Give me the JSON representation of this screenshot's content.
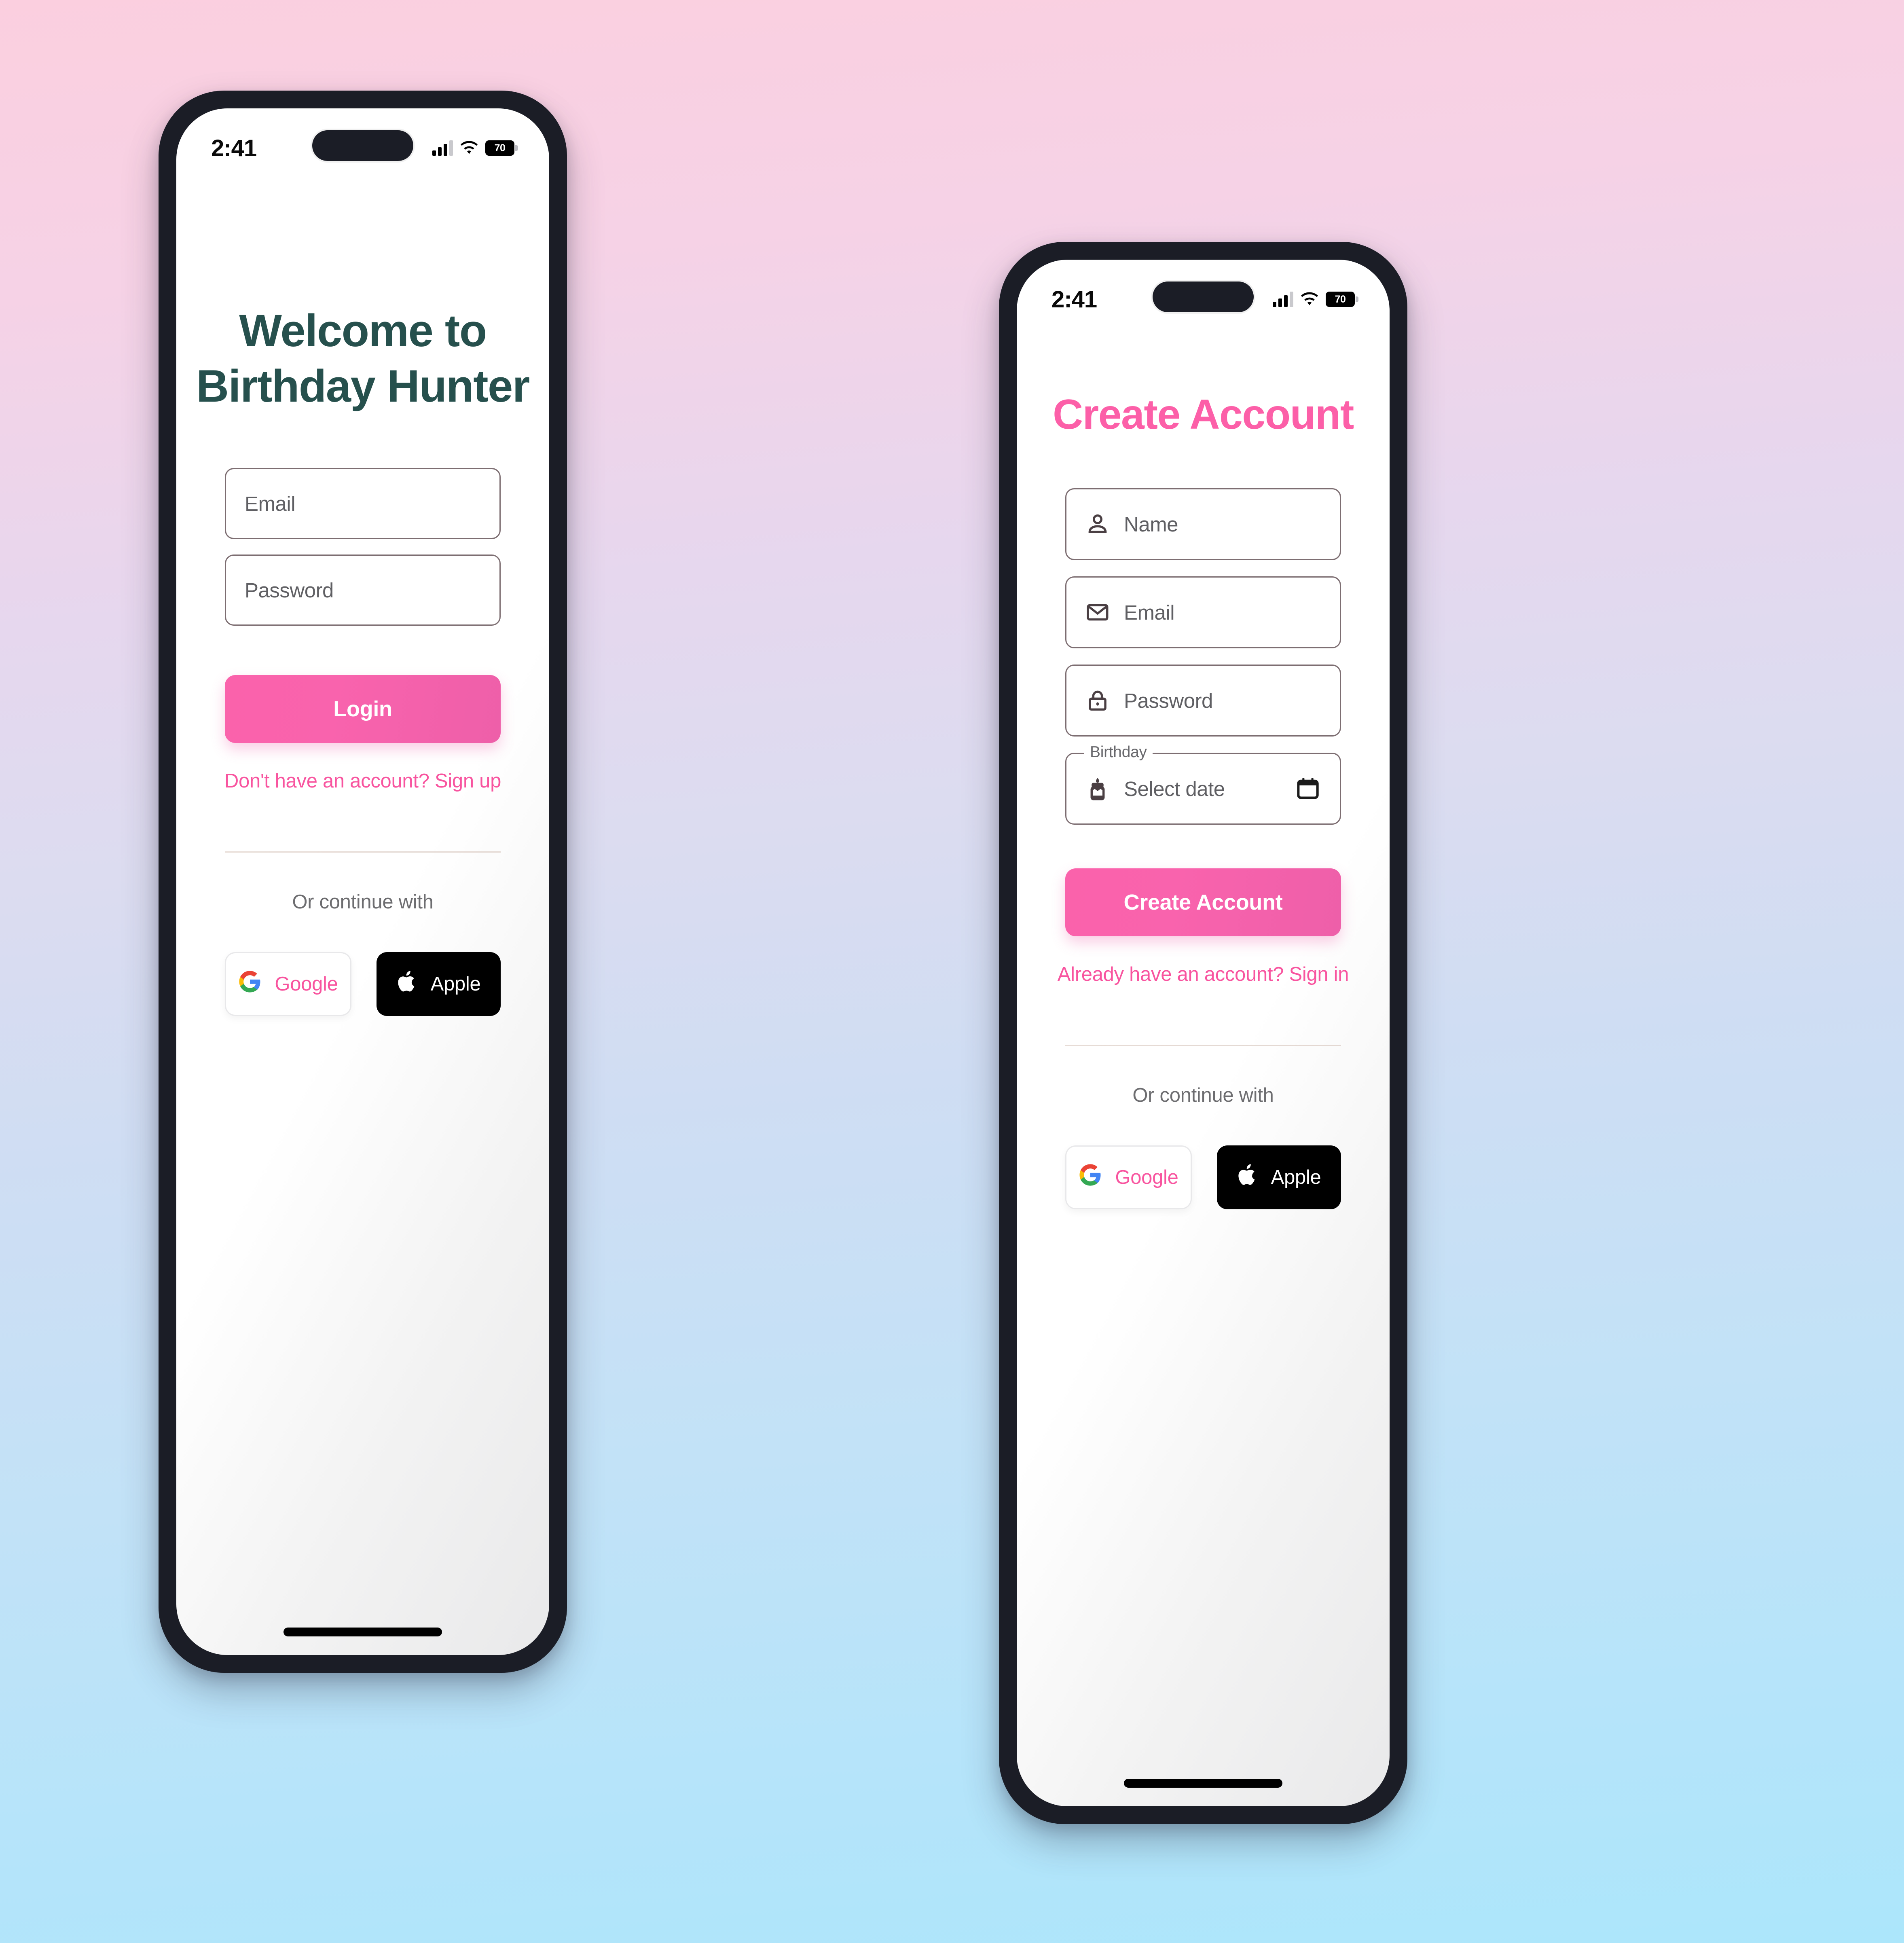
{
  "background": {
    "top_color": "#fbcfdf",
    "bottom_color": "#ace6fb"
  },
  "theme": {
    "accent_pink": "#fc5fa8",
    "link_pink": "#f8549f",
    "heading_teal": "#26504d",
    "field_border": "#7d6e72",
    "bezel": "#1b1d26"
  },
  "status_bar": {
    "time": "2:41",
    "battery_level": "70",
    "signal_icon": "cellular-signal-icon",
    "wifi_icon": "wifi-icon",
    "battery_icon": "battery-icon"
  },
  "login_screen": {
    "heading_line1": "Welcome to",
    "heading_line2": "Birthday Hunter",
    "fields": [
      {
        "name": "email",
        "placeholder": "Email"
      },
      {
        "name": "password",
        "placeholder": "Password"
      }
    ],
    "primary_button": "Login",
    "alt_link": "Don't have an account? Sign up",
    "or_text": "Or continue with",
    "social": [
      {
        "name": "google",
        "label": "Google",
        "icon": "google-logo-icon"
      },
      {
        "name": "apple",
        "label": "Apple",
        "icon": "apple-logo-icon"
      }
    ]
  },
  "signup_screen": {
    "title": "Create Account",
    "fields": [
      {
        "name": "name",
        "placeholder": "Name",
        "icon": "person-icon"
      },
      {
        "name": "email",
        "placeholder": "Email",
        "icon": "envelope-icon"
      },
      {
        "name": "password",
        "placeholder": "Password",
        "icon": "lock-icon"
      },
      {
        "name": "birthday",
        "label": "Birthday",
        "placeholder": "Select date",
        "icon": "birthday-cake-icon",
        "trailing_icon": "calendar-icon"
      }
    ],
    "primary_button": "Create Account",
    "alt_link": "Already have an account? Sign in",
    "or_text": "Or continue with",
    "social": [
      {
        "name": "google",
        "label": "Google",
        "icon": "google-logo-icon"
      },
      {
        "name": "apple",
        "label": "Apple",
        "icon": "apple-logo-icon"
      }
    ]
  }
}
